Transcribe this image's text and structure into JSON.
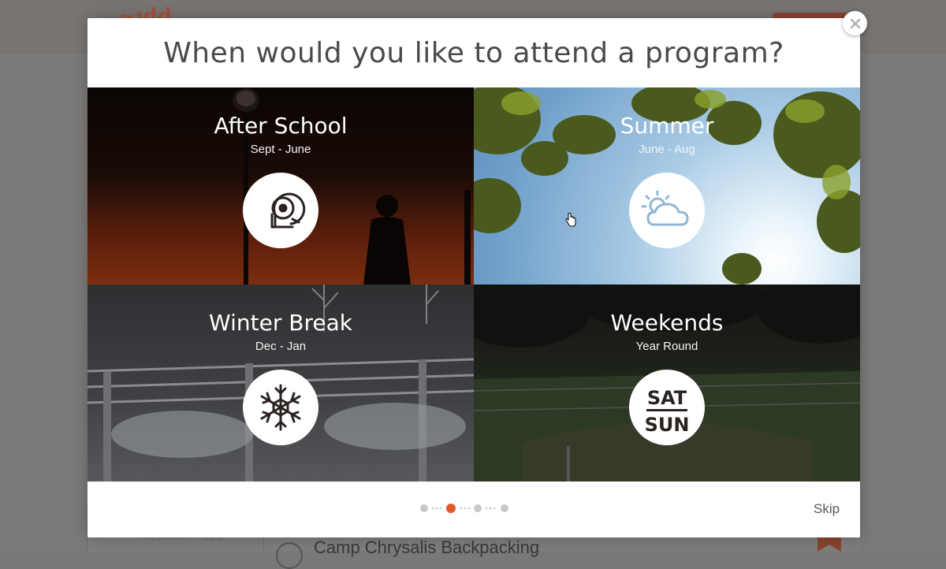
{
  "background_page": {
    "item_title": "Camp Chrysalis Backpacking",
    "sidebar_text": "...applicable Apply"
  },
  "modal": {
    "title": "When would you like to attend a program?",
    "close_label": "×",
    "options": [
      {
        "title": "After School",
        "subtitle": "Sept - June",
        "icon": "school-bell-icon"
      },
      {
        "title": "Summer",
        "subtitle": "June - Aug",
        "icon": "sun-cloud-icon"
      },
      {
        "title": "Winter Break",
        "subtitle": "Dec - Jan",
        "icon": "snowflake-icon"
      },
      {
        "title": "Weekends",
        "subtitle": "Year Round",
        "icon": "sat-sun-icon",
        "icon_text_top": "SAT",
        "icon_text_bottom": "SUN"
      }
    ],
    "pagination": {
      "total_steps": 4,
      "current_step": 2
    },
    "skip_label": "Skip"
  },
  "colors": {
    "accent": "#e05a2b",
    "dot_inactive": "#c8c8c8",
    "icon_stroke": "#2b2320"
  }
}
